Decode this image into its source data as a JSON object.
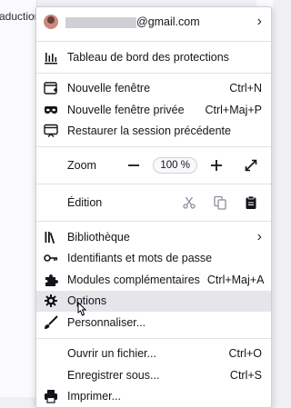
{
  "background": {
    "partial_text": "aduction"
  },
  "account": {
    "email_suffix": "@gmail.com"
  },
  "protections": {
    "label": "Tableau de bord des protections"
  },
  "window_items": [
    {
      "label": "Nouvelle fenêtre",
      "shortcut": "Ctrl+N"
    },
    {
      "label": "Nouvelle fenêtre privée",
      "shortcut": "Ctrl+Maj+P"
    },
    {
      "label": "Restaurer la session précédente",
      "shortcut": ""
    }
  ],
  "zoom": {
    "label": "Zoom",
    "minus": "—",
    "value": "100 %",
    "plus": "+"
  },
  "edit": {
    "label": "Édition"
  },
  "tools": [
    {
      "label": "Bibliothèque",
      "shortcut": ""
    },
    {
      "label": "Identifiants et mots de passe",
      "shortcut": ""
    },
    {
      "label": "Modules complémentaires",
      "shortcut": "Ctrl+Maj+A"
    },
    {
      "label": "Options",
      "shortcut": ""
    },
    {
      "label": "Personnaliser...",
      "shortcut": ""
    }
  ],
  "file_items": [
    {
      "label": "Ouvrir un fichier...",
      "shortcut": "Ctrl+O"
    },
    {
      "label": "Enregistrer sous...",
      "shortcut": "Ctrl+S"
    },
    {
      "label": "Imprimer...",
      "shortcut": ""
    }
  ],
  "colors": {
    "hover": "#e5e5ea",
    "menu_bg": "#ffffff",
    "border": "#cfcfd8"
  }
}
